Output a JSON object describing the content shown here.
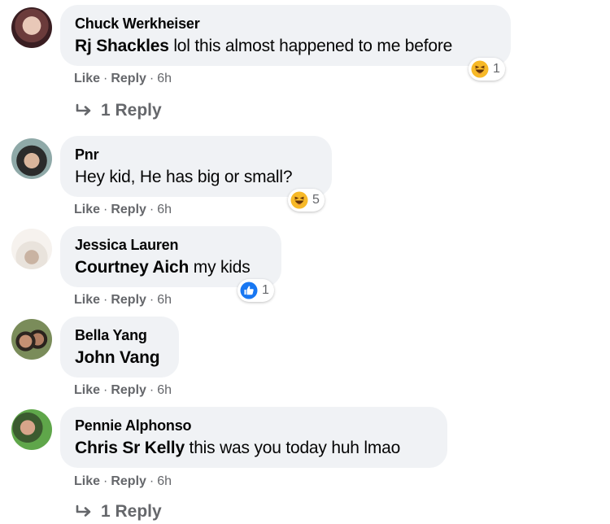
{
  "actions": {
    "like": "Like",
    "reply": "Reply",
    "dot": "·"
  },
  "comments": [
    {
      "author": "Chuck Werkheiser",
      "mention": "Rj Shackles",
      "text": " lol this almost happened to me before",
      "reaction": {
        "icon": "haha-icon",
        "count": "1"
      },
      "time": "6h",
      "replies": "1 Reply"
    },
    {
      "author": "Pnr",
      "mention": "",
      "text": "Hey kid, He has big or small?",
      "reaction": {
        "icon": "haha-icon",
        "count": "5"
      },
      "time": "6h"
    },
    {
      "author": "Jessica Lauren",
      "mention": "Courtney Aich",
      "text": " my kids",
      "reaction": {
        "icon": "like-icon",
        "count": "1"
      },
      "time": "6h"
    },
    {
      "author": "Bella Yang",
      "mention": "John Vang",
      "text": "",
      "time": "6h"
    },
    {
      "author": "Pennie Alphonso",
      "mention": "Chris Sr Kelly",
      "text": " this was you today huh lmao",
      "time": "6h",
      "replies": "1 Reply"
    }
  ],
  "colors": {
    "bubble": "#f0f2f5",
    "meta": "#65676b",
    "like_blue": "#1877f2",
    "haha_yellow": "#f7b928"
  }
}
